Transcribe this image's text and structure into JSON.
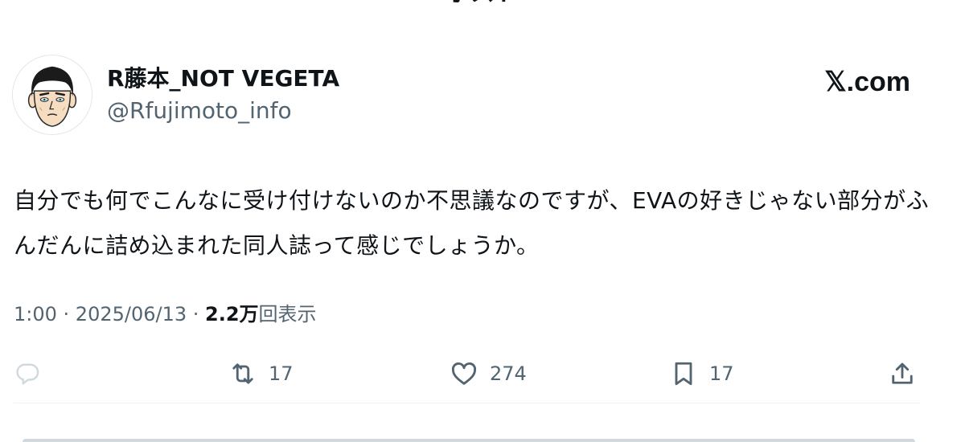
{
  "header": {
    "title": "ポスト"
  },
  "author": {
    "display_name": "R藤本_NOT VEGETA",
    "handle": "@Rfujimoto_info"
  },
  "brand": {
    "label": "𝕏.com"
  },
  "post": {
    "text": "自分でも何でこんなに受け付けないのか不思議なのですが、EVAの好きじゃない部分がふんだんに詰め込まれた同人誌って感じでしょうか。"
  },
  "meta": {
    "time": "1:00",
    "separator": " · ",
    "date": "2025/06/13",
    "views_count": "2.2万",
    "views_label": "回表示"
  },
  "actions": {
    "reply": {
      "icon": "reply-icon",
      "count": ""
    },
    "repost": {
      "icon": "repost-icon",
      "count": "17"
    },
    "like": {
      "icon": "heart-icon",
      "count": "274"
    },
    "bookmark": {
      "icon": "bookmark-icon",
      "count": "17"
    },
    "share": {
      "icon": "share-icon"
    }
  },
  "colors": {
    "text_primary": "#0f1419",
    "text_secondary": "#536471",
    "divider": "#eff3f4"
  }
}
